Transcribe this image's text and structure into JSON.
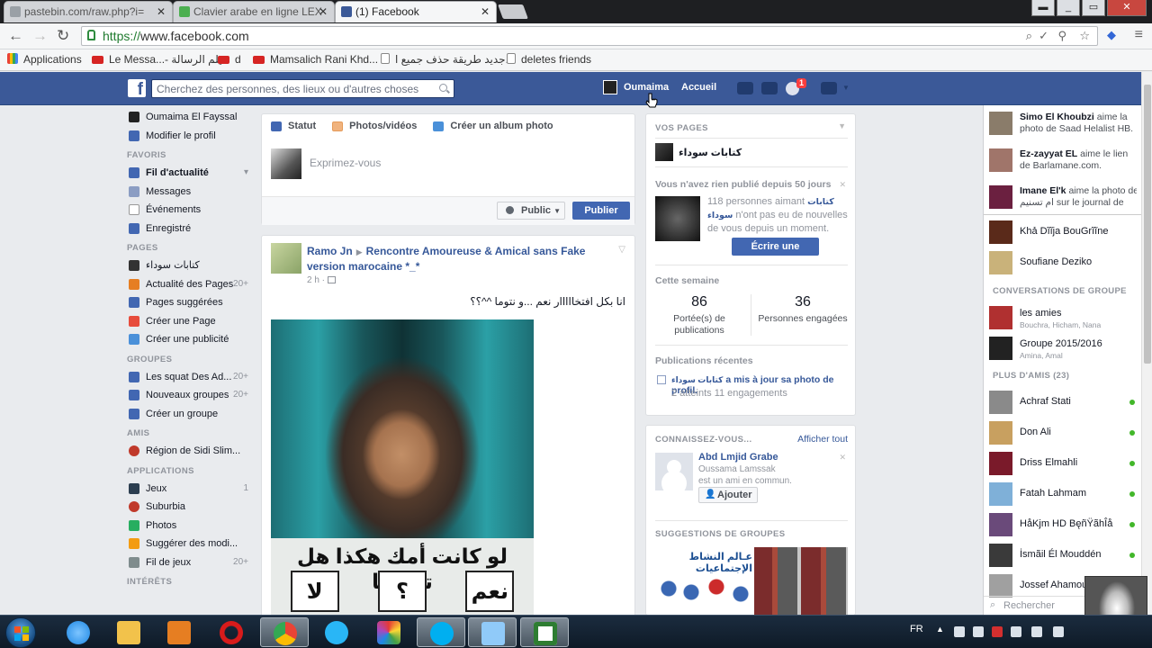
{
  "browser": {
    "tabs": [
      {
        "title": "pastebin.com/raw.php?i=",
        "icon_color": "#9aa0a6"
      },
      {
        "title": "Clavier arabe en ligne LEX",
        "icon_color": "#4caf50"
      },
      {
        "title": "(1) Facebook",
        "icon_color": "#3b5998"
      }
    ],
    "url_scheme": "https://",
    "url_host": "www.facebook.com",
    "bookmarks": [
      {
        "label": "Applications",
        "icon": "apps-icon"
      },
      {
        "label": "Le Messa...- فيلم الرسالة",
        "icon": "youtube-icon"
      },
      {
        "label": "d",
        "icon": "youtube-icon"
      },
      {
        "label": "Mamsalich Rani Khd...",
        "icon": "youtube-icon"
      },
      {
        "label": "جديد طريقة حذف جميع ا...",
        "icon": "doc-icon"
      },
      {
        "label": "deletes friends",
        "icon": "doc-icon"
      }
    ]
  },
  "fb_header": {
    "search_placeholder": "Cherchez des personnes, des lieux ou d'autres choses",
    "user_name": "Oumaima",
    "home": "Accueil",
    "notifications_count": "1"
  },
  "left_nav": {
    "profile_name": "Oumaima El Fayssal",
    "edit_profile": "Modifier le profil",
    "favorites_header": "FAVORIS",
    "favorites": [
      {
        "label": "Fil d'actualité",
        "count": "",
        "color": "#4267b2"
      },
      {
        "label": "Messages",
        "count": "",
        "color": "#8b9dc3"
      },
      {
        "label": "Événements",
        "count": "",
        "color": "#e74c3c"
      },
      {
        "label": "Enregistré",
        "count": "",
        "color": "#4267b2"
      }
    ],
    "pages_header": "PAGES",
    "pages": [
      {
        "label": "كتابات سوداء",
        "count": "",
        "color": "#333"
      },
      {
        "label": "Actualité des Pages",
        "count": "20+",
        "color": "#e67e22"
      },
      {
        "label": "Pages suggérées",
        "count": "",
        "color": "#4267b2"
      },
      {
        "label": "Créer une Page",
        "count": "",
        "color": "#e74c3c"
      },
      {
        "label": "Créer une publicité",
        "count": "",
        "color": "#4a90d9"
      }
    ],
    "groups_header": "GROUPES",
    "groups": [
      {
        "label": "Les squat Des Ad...",
        "count": "20+",
        "color": "#4267b2"
      },
      {
        "label": "Nouveaux groupes",
        "count": "20+",
        "color": "#4267b2"
      },
      {
        "label": "Créer un groupe",
        "count": "",
        "color": "#4267b2"
      }
    ],
    "friends_header": "AMIS",
    "friends": [
      {
        "label": "Région de Sidi Slim...",
        "count": "",
        "color": "#c0392b"
      }
    ],
    "apps_header": "APPLICATIONS",
    "apps": [
      {
        "label": "Jeux",
        "count": "1",
        "color": "#2c3e50"
      },
      {
        "label": "Suburbia",
        "count": "",
        "color": "#c0392b"
      },
      {
        "label": "Photos",
        "count": "",
        "color": "#27ae60"
      },
      {
        "label": "Suggérer des modi...",
        "count": "",
        "color": "#f39c12"
      },
      {
        "label": "Fil de jeux",
        "count": "20+",
        "color": "#7f8c8d"
      }
    ],
    "interests_header": "INTÉRÊTS"
  },
  "composer": {
    "tab_status": "Statut",
    "tab_photos": "Photos/vidéos",
    "tab_album": "Créer un album photo",
    "placeholder": "Exprimez-vous",
    "privacy": "Public",
    "publish": "Publier"
  },
  "post": {
    "author": "Ramo Jn",
    "group": "Rencontre Amoureuse & Amical sans Fake version marocaine *_*",
    "time": "2 h",
    "text": "انا بكل افتخااااار نعم ...و نتوما ^^؟؟",
    "image_caption": "لو كانت أمك هكذا هل تقبلها",
    "answers": [
      "لا",
      "؟",
      "نعم"
    ]
  },
  "pages_panel": {
    "header": "VOS PAGES",
    "page_name": "كتابات سوداء",
    "notice_title": "Vous n'avez rien publié depuis 50 jours",
    "notice_body_1": "118 personnes aimant",
    "notice_body_page": "كتابات سوداء",
    "notice_body_2": "n'ont pas eu de nouvelles de vous depuis un moment.",
    "write_button": "Écrire une publication",
    "week_header": "Cette semaine",
    "reach_value": "86",
    "reach_label": "Portée(s) de publications",
    "engaged_value": "36",
    "engaged_label": "Personnes engagées",
    "recent_header": "Publications récentes",
    "recent_page": "كتابات سوداء",
    "recent_action": "a mis à jour sa photo de profil.",
    "recent_stats": "2 atteints 11 engagements"
  },
  "pymk": {
    "header": "CONNAISSEZ-VOUS...",
    "see_all": "Afficher tout",
    "name": "Abd Lmjid Grabe",
    "mutual_line_1": "Oussama Lamssak",
    "mutual_line_2": "est un ami en commun.",
    "add_button": "Ajouter",
    "groups_header": "SUGGESTIONS DE GROUPES",
    "group_image_text": "عـالم النشاط الإجتماعيات"
  },
  "ticker": [
    {
      "name": "Simo El Khoubzi",
      "text": "aime la photo de Saad Helalist HB.",
      "color": "#8a7c6a"
    },
    {
      "name": "Ez-zayyat EL",
      "text": "aime le lien de Barlamane.com.",
      "color": "#a0756a"
    },
    {
      "name": "Imane El'k",
      "text": "aime la photo de ام تسنيم sur le journal de",
      "color": "#6b2040"
    }
  ],
  "chat": {
    "top": [
      {
        "name": "Khả Dĩĩja BouGrĩĩne",
        "color": "#5a2a1a"
      },
      {
        "name": "Soufiane Deziko",
        "color": "#c9b27a"
      }
    ],
    "groups_header": "CONVERSATIONS DE GROUPE",
    "groups": [
      {
        "name": "les amies",
        "members": "Bouchra, Hicham, Nana",
        "color": "#b03030"
      },
      {
        "name": "Groupe 2015/2016",
        "members": "Amina, Amal",
        "color": "#222"
      }
    ],
    "more_header": "PLUS D'AMIS (23)",
    "friends": [
      {
        "name": "Achraf Stati",
        "color": "#8a8a8a"
      },
      {
        "name": "Don Ali",
        "color": "#c8a060"
      },
      {
        "name": "Driss Elmahli",
        "color": "#7a1a2a"
      },
      {
        "name": "Fatah Lahmam",
        "color": "#7fb0d8"
      },
      {
        "name": "HåKjm HD BęñŸãhÎå",
        "color": "#6a4a7a"
      },
      {
        "name": "İsmãil Él Mouddén",
        "color": "#3a3a3a"
      },
      {
        "name": "Jossef Ahamout",
        "color": "#a0a0a0"
      }
    ],
    "search_placeholder": "Rechercher"
  },
  "taskbar": {
    "language": "FR",
    "apps": [
      {
        "name": "ie-icon",
        "color": "#1e88e5"
      },
      {
        "name": "explorer-icon",
        "color": "#f2c24b"
      },
      {
        "name": "media-player-icon",
        "color": "#e67e22"
      },
      {
        "name": "opera-icon",
        "color": "#d81b1b"
      },
      {
        "name": "chrome-icon",
        "color": "#34a853"
      },
      {
        "name": "app-n-icon",
        "color": "#29b6f6"
      },
      {
        "name": "paint-icon",
        "color": "#ab47bc"
      },
      {
        "name": "skype-icon",
        "color": "#00aff0"
      },
      {
        "name": "notepad-icon",
        "color": "#90caf9"
      },
      {
        "name": "camtasia-icon",
        "color": "#2e7d32"
      }
    ]
  }
}
